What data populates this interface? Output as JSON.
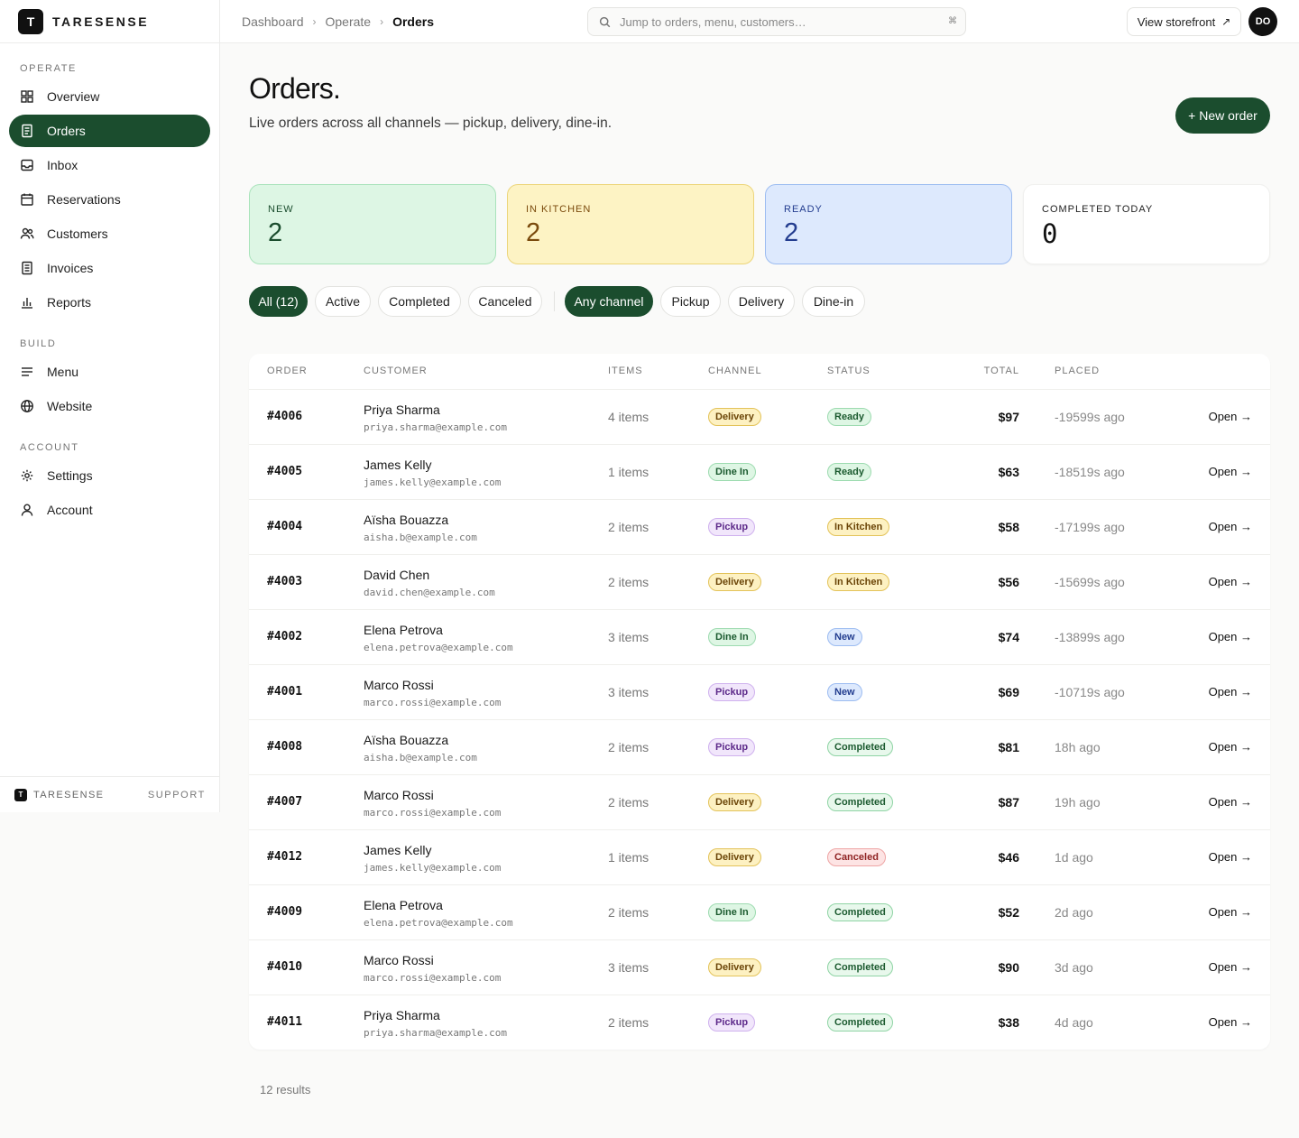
{
  "app": {
    "brand": "TARESENSE",
    "logo_letter": "T"
  },
  "sidebar": {
    "sections": [
      {
        "label": "OPERATE",
        "items": [
          {
            "label": "Overview",
            "icon": "grid-icon"
          },
          {
            "label": "Orders",
            "icon": "receipt-icon",
            "active": true
          },
          {
            "label": "Inbox",
            "icon": "inbox-icon"
          },
          {
            "label": "Reservations",
            "icon": "calendar-icon"
          },
          {
            "label": "Customers",
            "icon": "users-icon"
          },
          {
            "label": "Invoices",
            "icon": "invoice-icon"
          },
          {
            "label": "Reports",
            "icon": "bar-chart-icon"
          }
        ]
      },
      {
        "label": "BUILD",
        "items": [
          {
            "label": "Menu",
            "icon": "menu-lines-icon"
          },
          {
            "label": "Website",
            "icon": "globe-icon"
          }
        ]
      },
      {
        "label": "ACCOUNT",
        "items": [
          {
            "label": "Settings",
            "icon": "gear-icon"
          },
          {
            "label": "Account",
            "icon": "user-icon"
          }
        ]
      }
    ],
    "footer": {
      "brand": "TARESENSE",
      "support": "SUPPORT"
    }
  },
  "topbar": {
    "breadcrumb": [
      "Dashboard",
      "Operate",
      "Orders"
    ],
    "search_placeholder": "Jump to orders, menu, customers…",
    "search_shortcut": "⌘",
    "storefront_label": "View storefront",
    "avatar_initials": "DO"
  },
  "header": {
    "title": "Orders.",
    "subtitle": "Live orders across all channels — pickup, delivery, dine-in.",
    "new_order_label": "+ New order"
  },
  "stats": [
    {
      "label": "NEW",
      "value": "2"
    },
    {
      "label": "IN KITCHEN",
      "value": "2"
    },
    {
      "label": "READY",
      "value": "2"
    },
    {
      "label": "COMPLETED TODAY",
      "value": "0"
    }
  ],
  "filters": {
    "status": [
      {
        "label": "All (12)",
        "active": true
      },
      {
        "label": "Active",
        "active": false
      },
      {
        "label": "Completed",
        "active": false
      },
      {
        "label": "Canceled",
        "active": false
      }
    ],
    "channel": [
      {
        "label": "Any channel",
        "active": true
      },
      {
        "label": "Pickup",
        "active": false
      },
      {
        "label": "Delivery",
        "active": false
      },
      {
        "label": "Dine-in",
        "active": false
      }
    ]
  },
  "table": {
    "columns": [
      "ORDER",
      "CUSTOMER",
      "ITEMS",
      "CHANNEL",
      "STATUS",
      "TOTAL",
      "PLACED"
    ],
    "open_label": "Open →",
    "rows": [
      {
        "order": "#4006",
        "name": "Priya Sharma",
        "email": "priya.sharma@example.com",
        "items": "4 items",
        "channel": "Delivery",
        "status": "Ready",
        "total": "$97",
        "placed": "-19599s ago"
      },
      {
        "order": "#4005",
        "name": "James Kelly",
        "email": "james.kelly@example.com",
        "items": "1 items",
        "channel": "Dine In",
        "status": "Ready",
        "total": "$63",
        "placed": "-18519s ago"
      },
      {
        "order": "#4004",
        "name": "Aïsha Bouazza",
        "email": "aisha.b@example.com",
        "items": "2 items",
        "channel": "Pickup",
        "status": "In Kitchen",
        "total": "$58",
        "placed": "-17199s ago"
      },
      {
        "order": "#4003",
        "name": "David Chen",
        "email": "david.chen@example.com",
        "items": "2 items",
        "channel": "Delivery",
        "status": "In Kitchen",
        "total": "$56",
        "placed": "-15699s ago"
      },
      {
        "order": "#4002",
        "name": "Elena Petrova",
        "email": "elena.petrova@example.com",
        "items": "3 items",
        "channel": "Dine In",
        "status": "New",
        "total": "$74",
        "placed": "-13899s ago"
      },
      {
        "order": "#4001",
        "name": "Marco Rossi",
        "email": "marco.rossi@example.com",
        "items": "3 items",
        "channel": "Pickup",
        "status": "New",
        "total": "$69",
        "placed": "-10719s ago"
      },
      {
        "order": "#4008",
        "name": "Aïsha Bouazza",
        "email": "aisha.b@example.com",
        "items": "2 items",
        "channel": "Pickup",
        "status": "Completed",
        "total": "$81",
        "placed": "18h ago"
      },
      {
        "order": "#4007",
        "name": "Marco Rossi",
        "email": "marco.rossi@example.com",
        "items": "2 items",
        "channel": "Delivery",
        "status": "Completed",
        "total": "$87",
        "placed": "19h ago"
      },
      {
        "order": "#4012",
        "name": "James Kelly",
        "email": "james.kelly@example.com",
        "items": "1 items",
        "channel": "Delivery",
        "status": "Canceled",
        "total": "$46",
        "placed": "1d ago"
      },
      {
        "order": "#4009",
        "name": "Elena Petrova",
        "email": "elena.petrova@example.com",
        "items": "2 items",
        "channel": "Dine In",
        "status": "Completed",
        "total": "$52",
        "placed": "2d ago"
      },
      {
        "order": "#4010",
        "name": "Marco Rossi",
        "email": "marco.rossi@example.com",
        "items": "3 items",
        "channel": "Delivery",
        "status": "Completed",
        "total": "$90",
        "placed": "3d ago"
      },
      {
        "order": "#4011",
        "name": "Priya Sharma",
        "email": "priya.sharma@example.com",
        "items": "2 items",
        "channel": "Pickup",
        "status": "Completed",
        "total": "$38",
        "placed": "4d ago"
      }
    ]
  },
  "results_text": "12 results",
  "colors": {
    "accent": "#1b4d2e"
  }
}
